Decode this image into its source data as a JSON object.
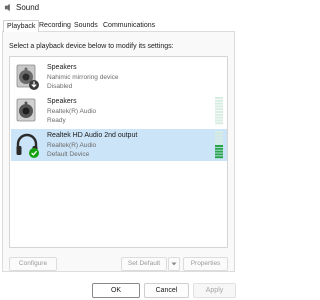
{
  "window": {
    "title": "Sound"
  },
  "tabs": [
    {
      "label": "Playback",
      "active": true
    },
    {
      "label": "Recording",
      "active": false
    },
    {
      "label": "Sounds",
      "active": false
    },
    {
      "label": "Communications",
      "active": false
    }
  ],
  "instruction": "Select a playback device below to modify its settings:",
  "devices": [
    {
      "name": "Speakers",
      "description": "Nahimic mirroring device",
      "status": "Disabled",
      "icon": "speaker-disabled-icon",
      "selected": false,
      "level": null
    },
    {
      "name": "Speakers",
      "description": "Realtek(R) Audio",
      "status": "Ready",
      "icon": "speaker-icon",
      "selected": false,
      "level": 0
    },
    {
      "name": "Realtek HD Audio 2nd output",
      "description": "Realtek(R) Audio",
      "status": "Default Device",
      "icon": "headphones-default-icon",
      "selected": true,
      "level": 0.5
    }
  ],
  "buttons": {
    "configure": "Configure",
    "set_default": "Set Default",
    "properties": "Properties",
    "ok": "OK",
    "cancel": "Cancel",
    "apply": "Apply"
  },
  "colors": {
    "selection": "#cce4f7",
    "meter_active": "#2aa54a",
    "meter_inactive": "#d7ece2",
    "status_check": "#13a10e",
    "status_disabled": "#333333"
  }
}
